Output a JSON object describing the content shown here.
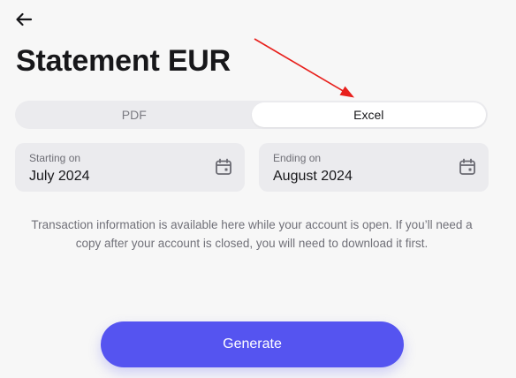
{
  "header": {
    "back_icon": "arrow-left-icon",
    "title": "Statement EUR"
  },
  "format_toggle": {
    "options": [
      "PDF",
      "Excel"
    ],
    "selected": "Excel"
  },
  "date_range": {
    "start": {
      "label": "Starting on",
      "value": "July 2024",
      "icon": "calendar-icon"
    },
    "end": {
      "label": "Ending on",
      "value": "August 2024",
      "icon": "calendar-icon"
    }
  },
  "info_text": "Transaction information is available here while your account is open. If you’ll need a copy after your account is closed, you will need to download it first.",
  "generate_label": "Generate",
  "colors": {
    "accent": "#5554f0",
    "annotation": "#e8201c",
    "background": "#f7f7f7"
  }
}
